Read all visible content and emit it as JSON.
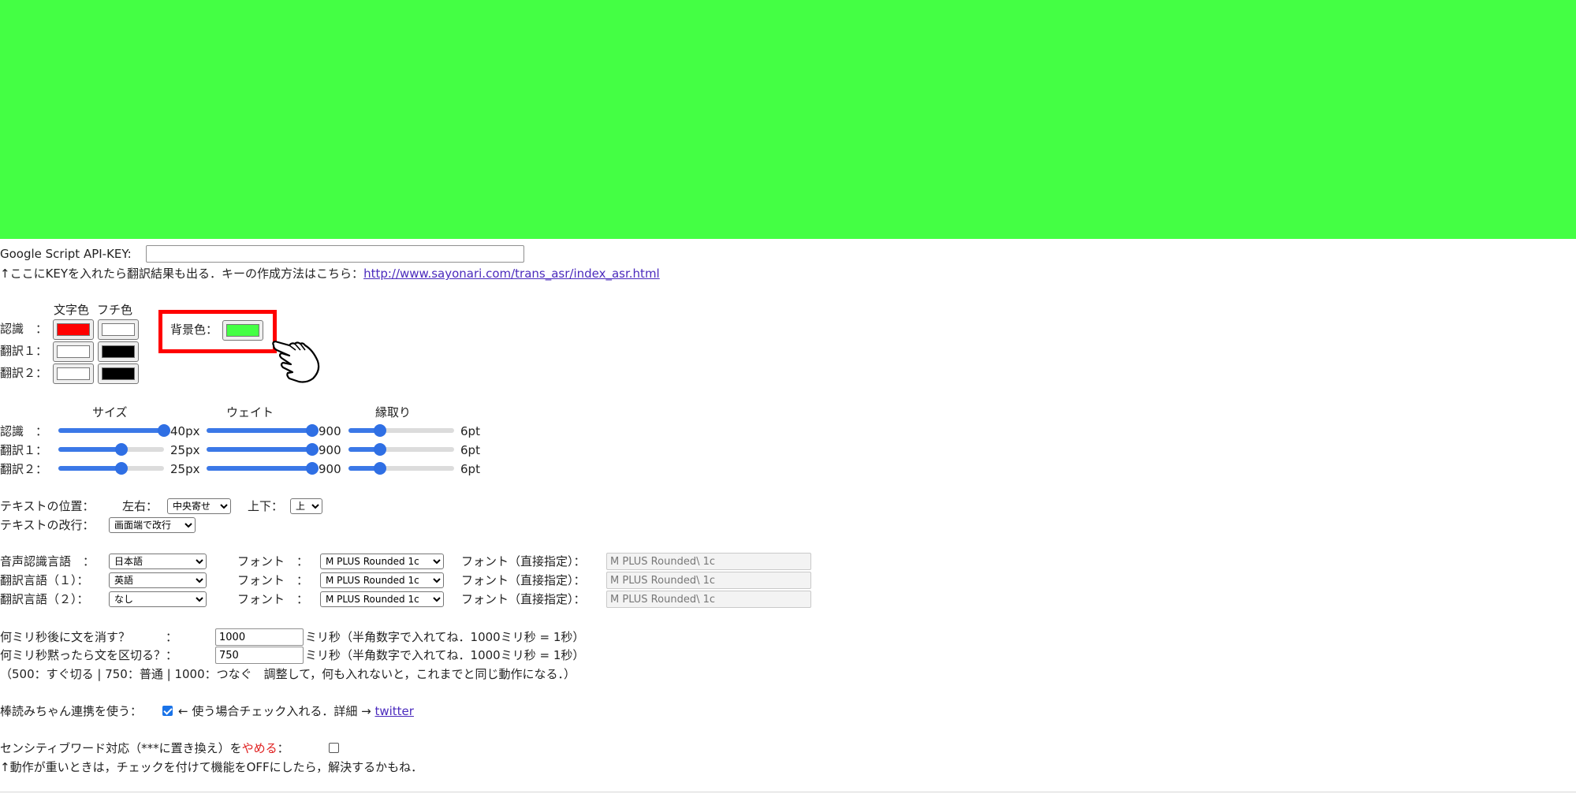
{
  "preview": {
    "background_color": "#44ff44"
  },
  "api_key": {
    "label": "Google Script API-KEY:",
    "value": "",
    "hint": "↑ここにKEYを入れたら翻訳結果も出る．キーの作成方法はこちら：",
    "link": "http://www.sayonari.com/trans_asr/index_asr.html"
  },
  "colors": {
    "header_text_color": "文字色",
    "header_outline_color": "フチ色",
    "rows": [
      {
        "label": "認識　：",
        "text_color": "#ff0000",
        "outline_color": "#ffffff"
      },
      {
        "label": "翻訳１：",
        "text_color": "#ffffff",
        "outline_color": "#000000"
      },
      {
        "label": "翻訳２：",
        "text_color": "#ffffff",
        "outline_color": "#000000"
      }
    ],
    "bg_label": "背景色：",
    "bg_color": "#44ff44"
  },
  "sliders": {
    "header_size": "サイズ",
    "header_weight": "ウェイト",
    "header_outline": "縁取り",
    "rows": [
      {
        "label": "認識　：",
        "size_level": 1.0,
        "size_value": "40px",
        "weight_level": 1.0,
        "weight_value": "900",
        "outline_level": 0.3,
        "outline_value": "6pt"
      },
      {
        "label": "翻訳１：",
        "size_level": 0.6,
        "size_value": "25px",
        "weight_level": 1.0,
        "weight_value": "900",
        "outline_level": 0.3,
        "outline_value": "6pt"
      },
      {
        "label": "翻訳２：",
        "size_level": 0.6,
        "size_value": "25px",
        "weight_level": 1.0,
        "weight_value": "900",
        "outline_level": 0.3,
        "outline_value": "6pt"
      }
    ]
  },
  "text_position": {
    "label": "テキストの位置：",
    "horizontal_label": "左右：",
    "horizontal_value": "中央寄せ",
    "vertical_label": "上下：",
    "vertical_value": "上"
  },
  "text_wrap": {
    "label": "テキストの改行：",
    "value": "画面端で改行"
  },
  "languages": {
    "font_label": "フォント　：",
    "font_direct_label": "フォント（直接指定）：",
    "rows": [
      {
        "label": "音声認識言語　：",
        "language": "日本語",
        "font": "M PLUS Rounded 1c",
        "font_direct": "M PLUS Rounded\\ 1c"
      },
      {
        "label": "翻訳言語（１）：",
        "language": "英語",
        "font": "M PLUS Rounded 1c",
        "font_direct": "M PLUS Rounded\\ 1c"
      },
      {
        "label": "翻訳言語（２）：",
        "language": "なし",
        "font": "M PLUS Rounded 1c",
        "font_direct": "M PLUS Rounded\\ 1c"
      }
    ]
  },
  "timing": {
    "erase_label": "何ミリ秒後に文を消す？　　　：",
    "erase_value": "1000",
    "erase_suffix": "ミリ秒（半角数字で入れてね．1000ミリ秒 = 1秒）",
    "split_label": "何ミリ秒黙ったら文を区切る？：",
    "split_value": "750",
    "split_suffix": "ミリ秒（半角数字で入れてね．1000ミリ秒 = 1秒）",
    "note": "（500：すぐ切る | 750：普通 | 1000：つなぐ　調整して，何も入れないと，これまでと同じ動作になる．）"
  },
  "bouyomi": {
    "label": "棒読みちゃん連携を使う：",
    "checked": true,
    "suffix": "← 使う場合チェック入れる．詳細 →",
    "link": "twitter"
  },
  "sensitive": {
    "label": "センシティブワード対応（***に置き換え）を",
    "label_red": "やめる",
    "label_end": "：",
    "checked": false,
    "note": "↑動作が重いときは，チェックを付けて機能をOFFにしたら，解決するかもね．"
  }
}
